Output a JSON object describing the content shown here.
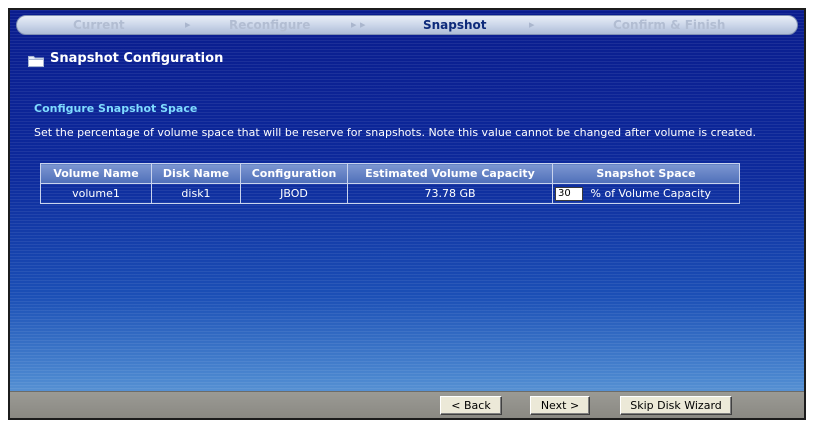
{
  "wizard": {
    "steps": [
      {
        "label": "Current",
        "active": false
      },
      {
        "label": "Reconfigure",
        "active": false
      },
      {
        "label": "Snapshot",
        "active": true
      },
      {
        "label": "Confirm & Finish",
        "active": false
      }
    ],
    "arrows": [
      "▸",
      "▸ ▸",
      "▸"
    ]
  },
  "page": {
    "title": "Snapshot Configuration",
    "title_icon": "folder-icon"
  },
  "section": {
    "heading": "Configure Snapshot Space",
    "description": "Set the percentage of volume space that will be reserve for snapshots. Note this value cannot be changed after volume is created."
  },
  "table": {
    "headers": [
      "Volume Name",
      "Disk Name",
      "Configuration",
      "Estimated Volume Capacity",
      "Snapshot Space"
    ],
    "rows": [
      {
        "volume_name": "volume1",
        "disk_name": "disk1",
        "configuration": "JBOD",
        "estimated_capacity": "73.78 GB",
        "snapshot_value": "30",
        "snapshot_suffix": "% of Volume Capacity"
      }
    ]
  },
  "buttons": {
    "back": "< Back",
    "next": "Next >",
    "skip": "Skip Disk Wizard"
  },
  "colors": {
    "background": "#0d2a9c",
    "heading_accent": "#7fdcff",
    "active_step": "#0d2a7a",
    "button_bar": "#8a8983"
  }
}
